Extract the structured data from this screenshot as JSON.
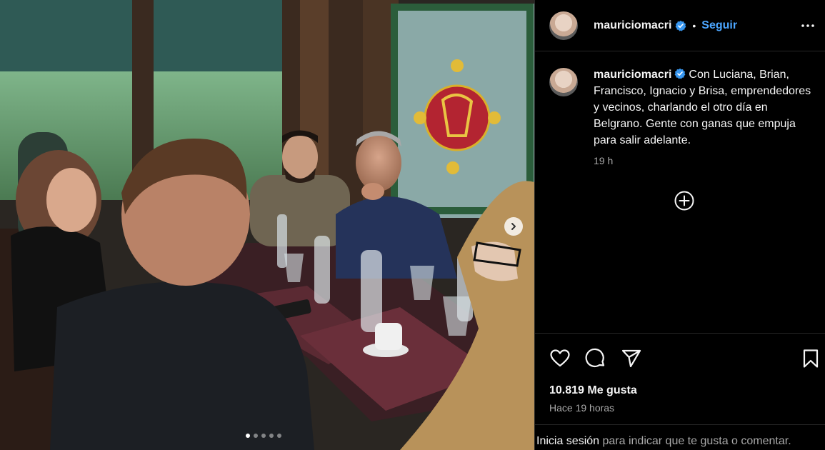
{
  "post": {
    "username": "mauriciomacri",
    "separator": "•",
    "follow_label": "Seguir",
    "caption": "Con Luciana, Brian, Francisco, Ignacio y Brisa, emprendedores y vecinos, charlando el otro día en Belgrano. Gente con ganas que empuja para salir adelante.",
    "caption_time": "19 h",
    "likes": "10.819 Me gusta",
    "posted_ago": "Hace 19 horas",
    "carousel": {
      "total": 5,
      "current": 1
    }
  },
  "login_bar": {
    "link": "Inicia sesión",
    "rest": " para indicar que te gusta o comentar."
  },
  "icons": {
    "verified": "verified-badge-icon",
    "more": "more-options-icon",
    "add_comment": "plus-circle-icon",
    "like": "heart-icon",
    "comment": "comment-icon",
    "share": "send-icon",
    "save": "bookmark-icon",
    "next": "chevron-right-icon"
  },
  "colors": {
    "background": "#000000",
    "text": "#f5f5f5",
    "muted": "#a8a8a8",
    "link": "#4ca6ff",
    "verified": "#3897f0"
  }
}
